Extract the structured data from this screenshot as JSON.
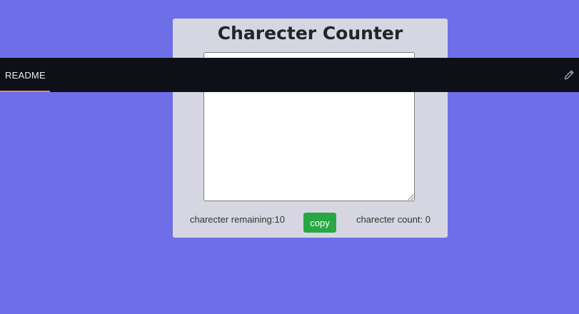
{
  "card": {
    "title": "Charecter Counter",
    "textarea_value": "",
    "remaining_text": "charecter remaining:10",
    "copy_label": "copy",
    "count_text": "charecter count: 0"
  },
  "readme_bar": {
    "tab_label": "README",
    "edit_icon": "pencil-icon"
  },
  "colors": {
    "page_background": "#6e6fe8",
    "card_background": "#d6d6e3",
    "copy_button": "#28a745",
    "readme_bar": "#0d1117",
    "tab_underline": "#f78166"
  }
}
